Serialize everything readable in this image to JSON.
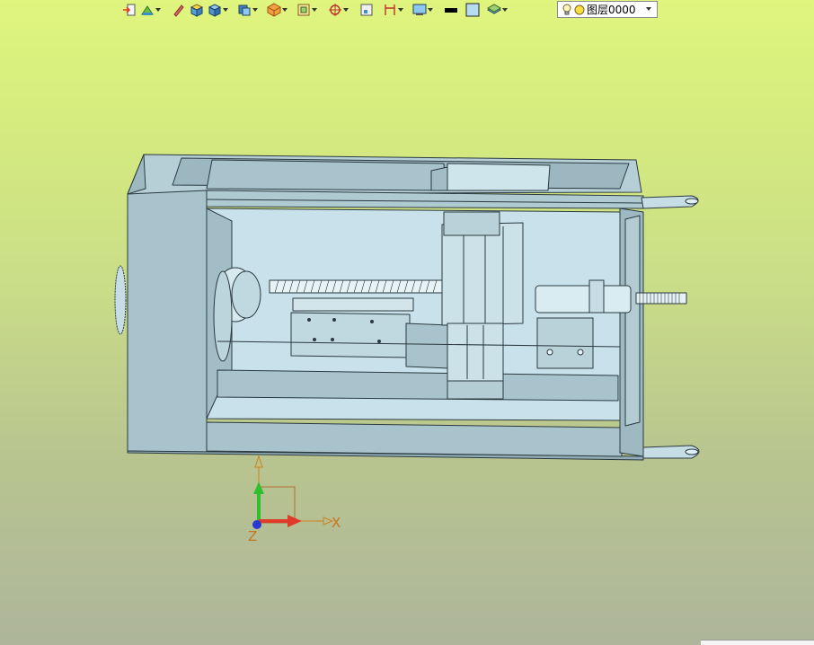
{
  "toolbar": {
    "buttons": [
      {
        "icon": "import-icon",
        "has_dropdown": false
      },
      {
        "icon": "sketch-icon",
        "has_dropdown": true
      },
      {
        "icon": "pencil-icon",
        "has_dropdown": false
      },
      {
        "icon": "box-shaded-icon",
        "has_dropdown": false
      },
      {
        "icon": "box-shaded-alt-icon",
        "has_dropdown": true
      },
      {
        "icon": "box-view-icon",
        "has_dropdown": true
      },
      {
        "icon": "render-style-icon",
        "has_dropdown": true
      },
      {
        "icon": "view-orient-icon",
        "has_dropdown": true
      },
      {
        "icon": "snap-target-icon",
        "has_dropdown": true
      },
      {
        "icon": "frame-icon",
        "has_dropdown": false
      },
      {
        "icon": "dimension-icon",
        "has_dropdown": true
      },
      {
        "icon": "display-settings-icon",
        "has_dropdown": true
      },
      {
        "icon": "line-color-icon",
        "has_dropdown": false
      },
      {
        "icon": "fill-color-icon",
        "has_dropdown": false
      },
      {
        "icon": "layers-icon",
        "has_dropdown": true
      }
    ],
    "layer": {
      "value": "图层0000",
      "icons": [
        "lightbulb-icon",
        "sun-icon"
      ]
    }
  },
  "triad": {
    "x_label": "X",
    "z_label": "Z"
  },
  "colors": {
    "background_top": "#dff57e",
    "background_bottom": "#aeb59b",
    "model_face": "#a9c3cc",
    "model_light": "#c6dde5",
    "model_edge": "#2b3a40",
    "axis_x": "#e03a2a",
    "axis_y": "#2fbf2f",
    "axis_z": "#2a3ad0",
    "triad_orange": "#d08020"
  }
}
